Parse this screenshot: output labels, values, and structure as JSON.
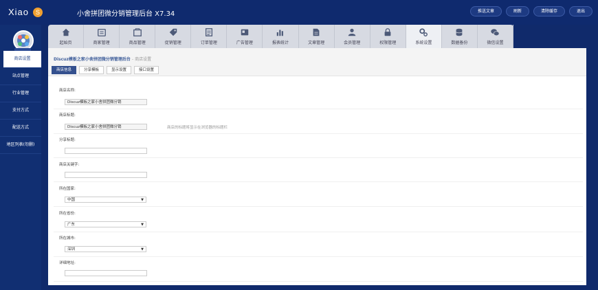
{
  "header": {
    "logo_text": "Xiao",
    "logo_badge": "S",
    "app_title": "小舍拼团微分销管理后台 X7.34",
    "buttons": [
      "推送文章",
      "刷新",
      "清除缓存",
      "退出"
    ]
  },
  "sidebar": {
    "items": [
      "商店设置",
      "站点管理",
      "行业管理",
      "支付方式",
      "配送方式",
      "地区列表(勿删)"
    ]
  },
  "tabs": [
    {
      "label": "起始页",
      "icon": "home-icon"
    },
    {
      "label": "商家管理",
      "icon": "shop-icon"
    },
    {
      "label": "商品管理",
      "icon": "goods-icon"
    },
    {
      "label": "促销管理",
      "icon": "tag-icon"
    },
    {
      "label": "订单管理",
      "icon": "order-icon"
    },
    {
      "label": "广告管理",
      "icon": "ad-icon"
    },
    {
      "label": "报表统计",
      "icon": "chart-icon"
    },
    {
      "label": "文章管理",
      "icon": "article-icon"
    },
    {
      "label": "会员管理",
      "icon": "member-icon"
    },
    {
      "label": "权限管理",
      "icon": "lock-icon"
    },
    {
      "label": "系统设置",
      "icon": "gear-icon"
    },
    {
      "label": "数据备份",
      "icon": "database-icon"
    },
    {
      "label": "微信设置",
      "icon": "wechat-icon"
    }
  ],
  "breadcrumb": {
    "main": "Discuz模板之家小舍拼团微分销管理后台",
    "sub": "- 商店设置"
  },
  "subtabs": [
    "商店信息",
    "分享模板",
    "显示设置",
    "接口设置"
  ],
  "form": {
    "shop_name_label": "商店名称:",
    "shop_name_value": "Discuz模板之家小舍拼团微分销",
    "shop_title_label": "商店标题:",
    "shop_title_value": "Discuz模板之家小舍拼团微分销",
    "shop_title_hint": "商店的标题将显示在浏览器的标题栏",
    "share_title_label": "分享标题:",
    "keywords_label": "商店关键字:",
    "country_label": "所在国家:",
    "country_value": "中国",
    "province_label": "所在省份:",
    "province_value": "广东",
    "city_label": "所在城市:",
    "city_value": "深圳",
    "address_label": "详细地址:",
    "select_arrow": "▼"
  },
  "colors": {
    "background": "#102a6b",
    "accent": "#34508e",
    "logo_badge": "#f0a030"
  }
}
